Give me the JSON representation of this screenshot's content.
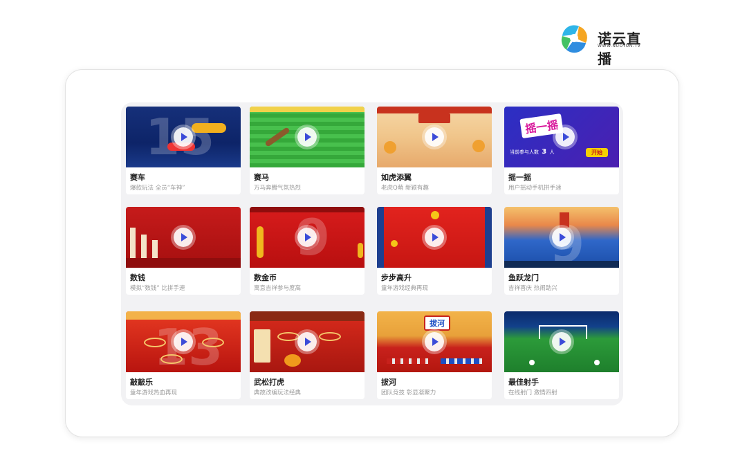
{
  "brand": {
    "name_cn": "诺云直播",
    "name_en": "WWW.NUOYUN.TV"
  },
  "colors": {
    "play_icon": "#3b4bd8",
    "title": "#222222",
    "subtitle": "#9a9a9a",
    "grid_bg": "#f2f2f4"
  },
  "games": [
    {
      "title": "赛车",
      "subtitle": "爆款玩法 全员“车神”"
    },
    {
      "title": "赛马",
      "subtitle": "万马奔腾气氛热烈"
    },
    {
      "title": "如虎添翼",
      "subtitle": "老虎Q萌 新颖有趣"
    },
    {
      "title": "摇一摇",
      "subtitle": "用户摇动手机拼手速"
    },
    {
      "title": "数钱",
      "subtitle": "模拟“数钱” 比拼手速"
    },
    {
      "title": "数金币",
      "subtitle": "寓意吉祥参与度高"
    },
    {
      "title": "步步高升",
      "subtitle": "童年游戏经典再现"
    },
    {
      "title": "鱼跃龙门",
      "subtitle": "吉祥喜庆 热闹助兴"
    },
    {
      "title": "敲敲乐",
      "subtitle": "童年游戏热血再现"
    },
    {
      "title": "武松打虎",
      "subtitle": "典故改编玩法经典"
    },
    {
      "title": "拔河",
      "subtitle": "团队竞技 彰显凝聚力"
    },
    {
      "title": "最佳射手",
      "subtitle": "在线射门 激情四射"
    }
  ],
  "thumb_text": {
    "race_num": "15",
    "shake_banner": "摇一摇",
    "shake_count_label": "当前参与人数",
    "shake_count": "3",
    "shake_count_unit": "人",
    "shake_button": "开始",
    "coin_num": "9",
    "tug_banner": "拔河",
    "fish_num": "9",
    "drum_num": "13"
  }
}
